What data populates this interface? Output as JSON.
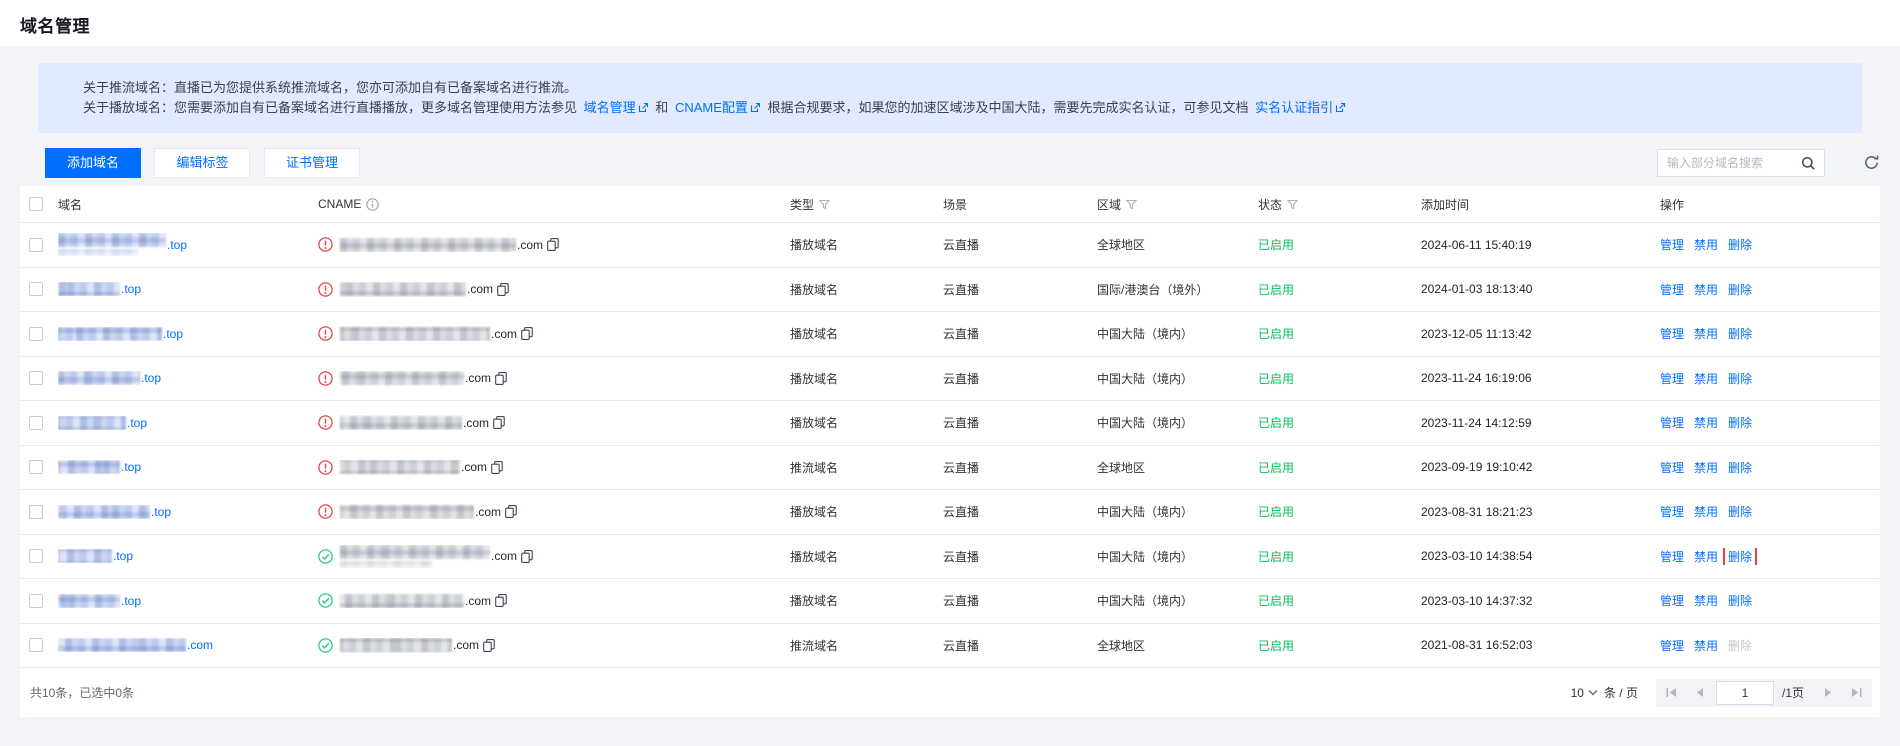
{
  "page": {
    "title": "域名管理"
  },
  "banner": {
    "line1_label": "关于推流域名：",
    "line1_text": "直播已为您提供系统推流域名，您亦可添加自有已备案域名进行推流。",
    "line2_label": "关于播放域名：",
    "line2_text1": "您需要添加自有已备案域名进行直播播放，更多域名管理使用方法参见",
    "line2_link1": "域名管理",
    "line2_text2": "和",
    "line2_link2": "CNAME配置",
    "line2_text3": "根据合规要求，如果您的加速区域涉及中国大陆，需要先完成实名认证，可参见文档",
    "line2_link3": "实名认证指引"
  },
  "toolbar": {
    "add_button": "添加域名",
    "edit_tags_button": "编辑标签",
    "cert_button": "证书管理",
    "search_placeholder": "输入部分域名搜索"
  },
  "table": {
    "headers": {
      "domain": "域名",
      "cname": "CNAME",
      "type": "类型",
      "scene": "场景",
      "region": "区域",
      "status": "状态",
      "added": "添加时间",
      "ops": "操作"
    },
    "ops_labels": [
      "管理",
      "禁用",
      "删除"
    ],
    "rows": [
      {
        "domain_suffix": ".top",
        "domain_blur": 108,
        "domain_blur2": 80,
        "cname_state": "warning",
        "cname_blur": 176,
        "cname_suffix": ".com",
        "type": "播放域名",
        "scene": "云直播",
        "region": "全球地区",
        "status": "已启用",
        "added": "2024-06-11 15:40:19"
      },
      {
        "domain_suffix": ".top",
        "domain_blur": 62,
        "cname_state": "warning",
        "cname_blur": 126,
        "cname_suffix": ".com",
        "type": "播放域名",
        "scene": "云直播",
        "region": "国际/港澳台（境外）",
        "status": "已启用",
        "added": "2024-01-03 18:13:40"
      },
      {
        "domain_suffix": ".top",
        "domain_blur": 104,
        "cname_state": "warning",
        "cname_blur": 150,
        "cname_suffix": ".com",
        "type": "播放域名",
        "scene": "云直播",
        "region": "中国大陆（境内）",
        "status": "已启用",
        "added": "2023-12-05 11:13:42"
      },
      {
        "domain_suffix": ".top",
        "domain_blur": 82,
        "cname_state": "warning",
        "cname_blur": 124,
        "cname_suffix": ".com",
        "type": "播放域名",
        "scene": "云直播",
        "region": "中国大陆（境内）",
        "status": "已启用",
        "added": "2023-11-24 16:19:06"
      },
      {
        "domain_suffix": ".top",
        "domain_blur": 68,
        "cname_state": "warning",
        "cname_blur": 122,
        "cname_suffix": ".com",
        "type": "播放域名",
        "scene": "云直播",
        "region": "中国大陆（境内）",
        "status": "已启用",
        "added": "2023-11-24 14:12:59"
      },
      {
        "domain_suffix": ".top",
        "domain_blur": 62,
        "cname_state": "warning",
        "cname_blur": 120,
        "cname_suffix": ".com",
        "type": "推流域名",
        "scene": "云直播",
        "region": "全球地区",
        "status": "已启用",
        "added": "2023-09-19 19:10:42"
      },
      {
        "domain_suffix": ".top",
        "domain_blur": 92,
        "cname_state": "warning",
        "cname_blur": 134,
        "cname_suffix": ".com",
        "type": "播放域名",
        "scene": "云直播",
        "region": "中国大陆（境内）",
        "status": "已启用",
        "added": "2023-08-31 18:21:23"
      },
      {
        "domain_suffix": ".top",
        "domain_blur": 54,
        "cname_state": "ok",
        "cname_blur": 150,
        "cname_blur2": 92,
        "cname_suffix": ".com",
        "type": "播放域名",
        "scene": "云直播",
        "region": "中国大陆（境内）",
        "status": "已启用",
        "added": "2023-03-10 14:38:54",
        "highlight_delete": true
      },
      {
        "domain_suffix": ".top",
        "domain_blur": 62,
        "cname_state": "ok",
        "cname_blur": 124,
        "cname_suffix": ".com",
        "type": "播放域名",
        "scene": "云直播",
        "region": "中国大陆（境内）",
        "status": "已启用",
        "added": "2023-03-10 14:37:32"
      },
      {
        "domain_suffix": ".com",
        "domain_blur": 128,
        "cname_state": "ok",
        "cname_blur": 112,
        "cname_suffix": ".com",
        "type": "推流域名",
        "scene": "云直播",
        "region": "全球地区",
        "status": "已启用",
        "added": "2021-08-31 16:52:03",
        "delete_disabled": true
      }
    ]
  },
  "pagination": {
    "total_text": "共10条，已选中0条",
    "page_size": "10",
    "per_page_label": "条 / 页",
    "current_page": "1",
    "total_pages_label": "/1页"
  }
}
